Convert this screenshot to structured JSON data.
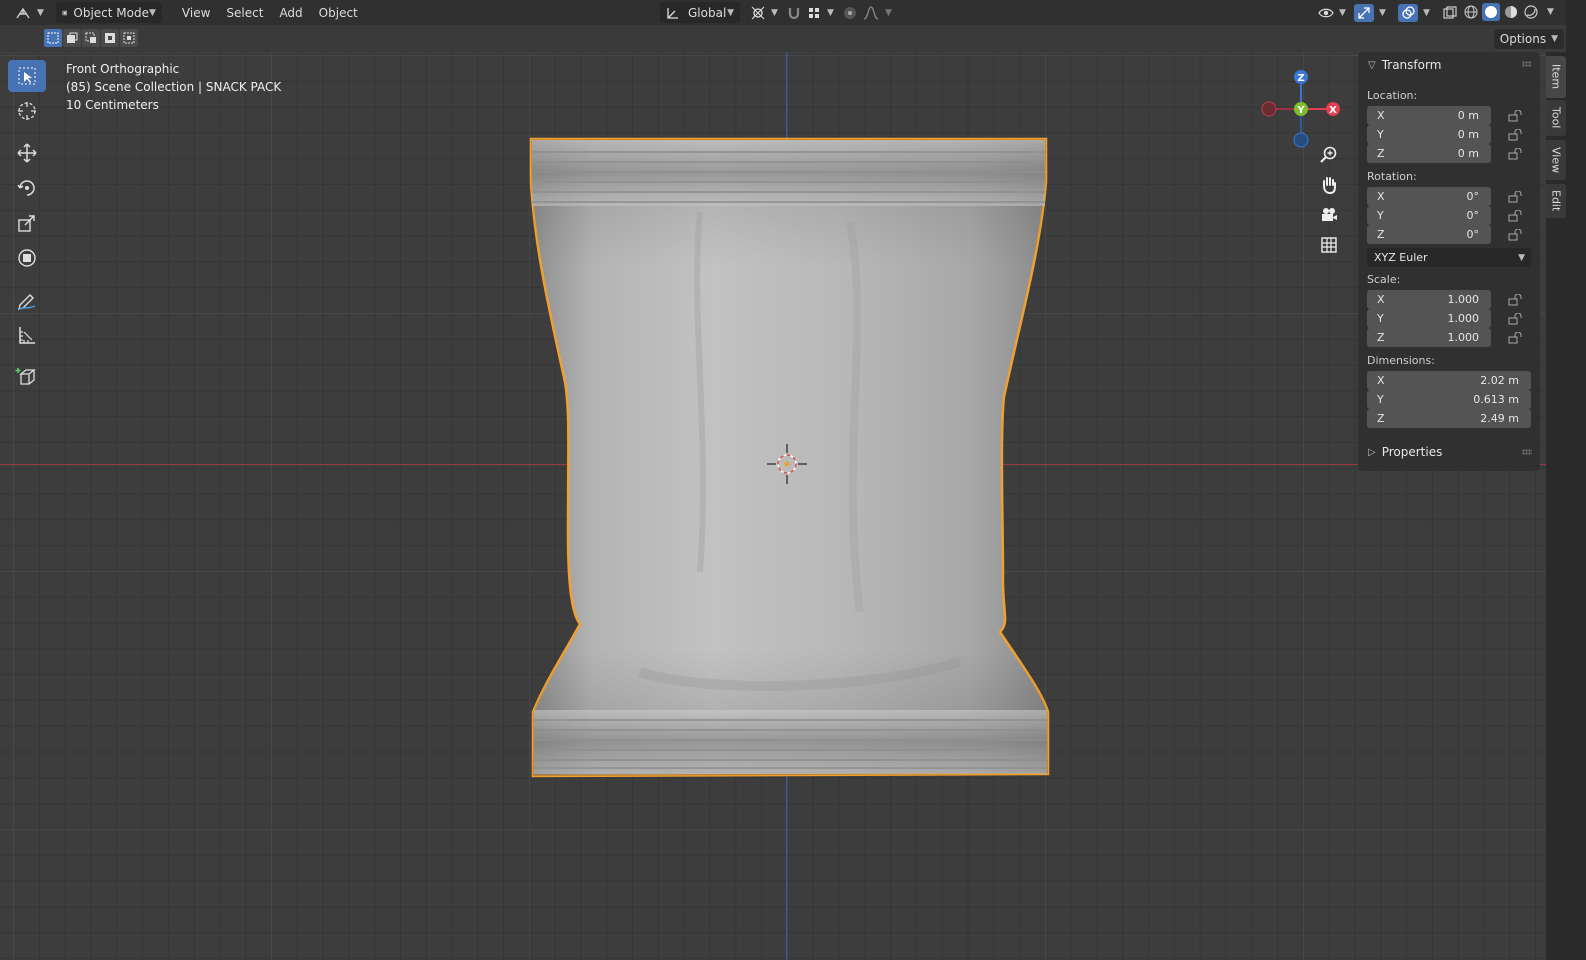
{
  "header": {
    "mode_label": "Object Mode",
    "menus": [
      "View",
      "Select",
      "Add",
      "Object"
    ],
    "orientation_label": "Global",
    "options_label": "Options"
  },
  "viewport": {
    "view_name": "Front Orthographic",
    "collection_info": "(85) Scene Collection | SNACK PACK",
    "grid_scale": "10 Centimeters",
    "gizmo_labels": {
      "z": "Z",
      "y": "Y",
      "x": "X"
    }
  },
  "toolbar": {
    "tools": [
      "select-box-tool",
      "cursor-tool",
      "move-tool",
      "rotate-tool",
      "scale-tool",
      "transform-tool",
      "annotate-tool",
      "measure-tool",
      "add-cube-tool"
    ]
  },
  "npanel": {
    "transform_title": "Transform",
    "location_label": "Location:",
    "location": [
      {
        "axis": "X",
        "value": "0 m"
      },
      {
        "axis": "Y",
        "value": "0 m"
      },
      {
        "axis": "Z",
        "value": "0 m"
      }
    ],
    "rotation_label": "Rotation:",
    "rotation": [
      {
        "axis": "X",
        "value": "0°"
      },
      {
        "axis": "Y",
        "value": "0°"
      },
      {
        "axis": "Z",
        "value": "0°"
      }
    ],
    "rotation_mode": "XYZ Euler",
    "scale_label": "Scale:",
    "scale": [
      {
        "axis": "X",
        "value": "1.000"
      },
      {
        "axis": "Y",
        "value": "1.000"
      },
      {
        "axis": "Z",
        "value": "1.000"
      }
    ],
    "dimensions_label": "Dimensions:",
    "dimensions": [
      {
        "axis": "X",
        "value": "2.02 m"
      },
      {
        "axis": "Y",
        "value": "0.613 m"
      },
      {
        "axis": "Z",
        "value": "2.49 m"
      }
    ],
    "properties_title": "Properties"
  },
  "sidetabs": [
    "Item",
    "Tool",
    "View",
    "Edit"
  ],
  "colors": {
    "accent": "#4772b3",
    "selection_outline": "#f0a030",
    "x_axis": "#e0404f",
    "y_axis": "#7bbf2e",
    "z_axis": "#3a78d8"
  }
}
